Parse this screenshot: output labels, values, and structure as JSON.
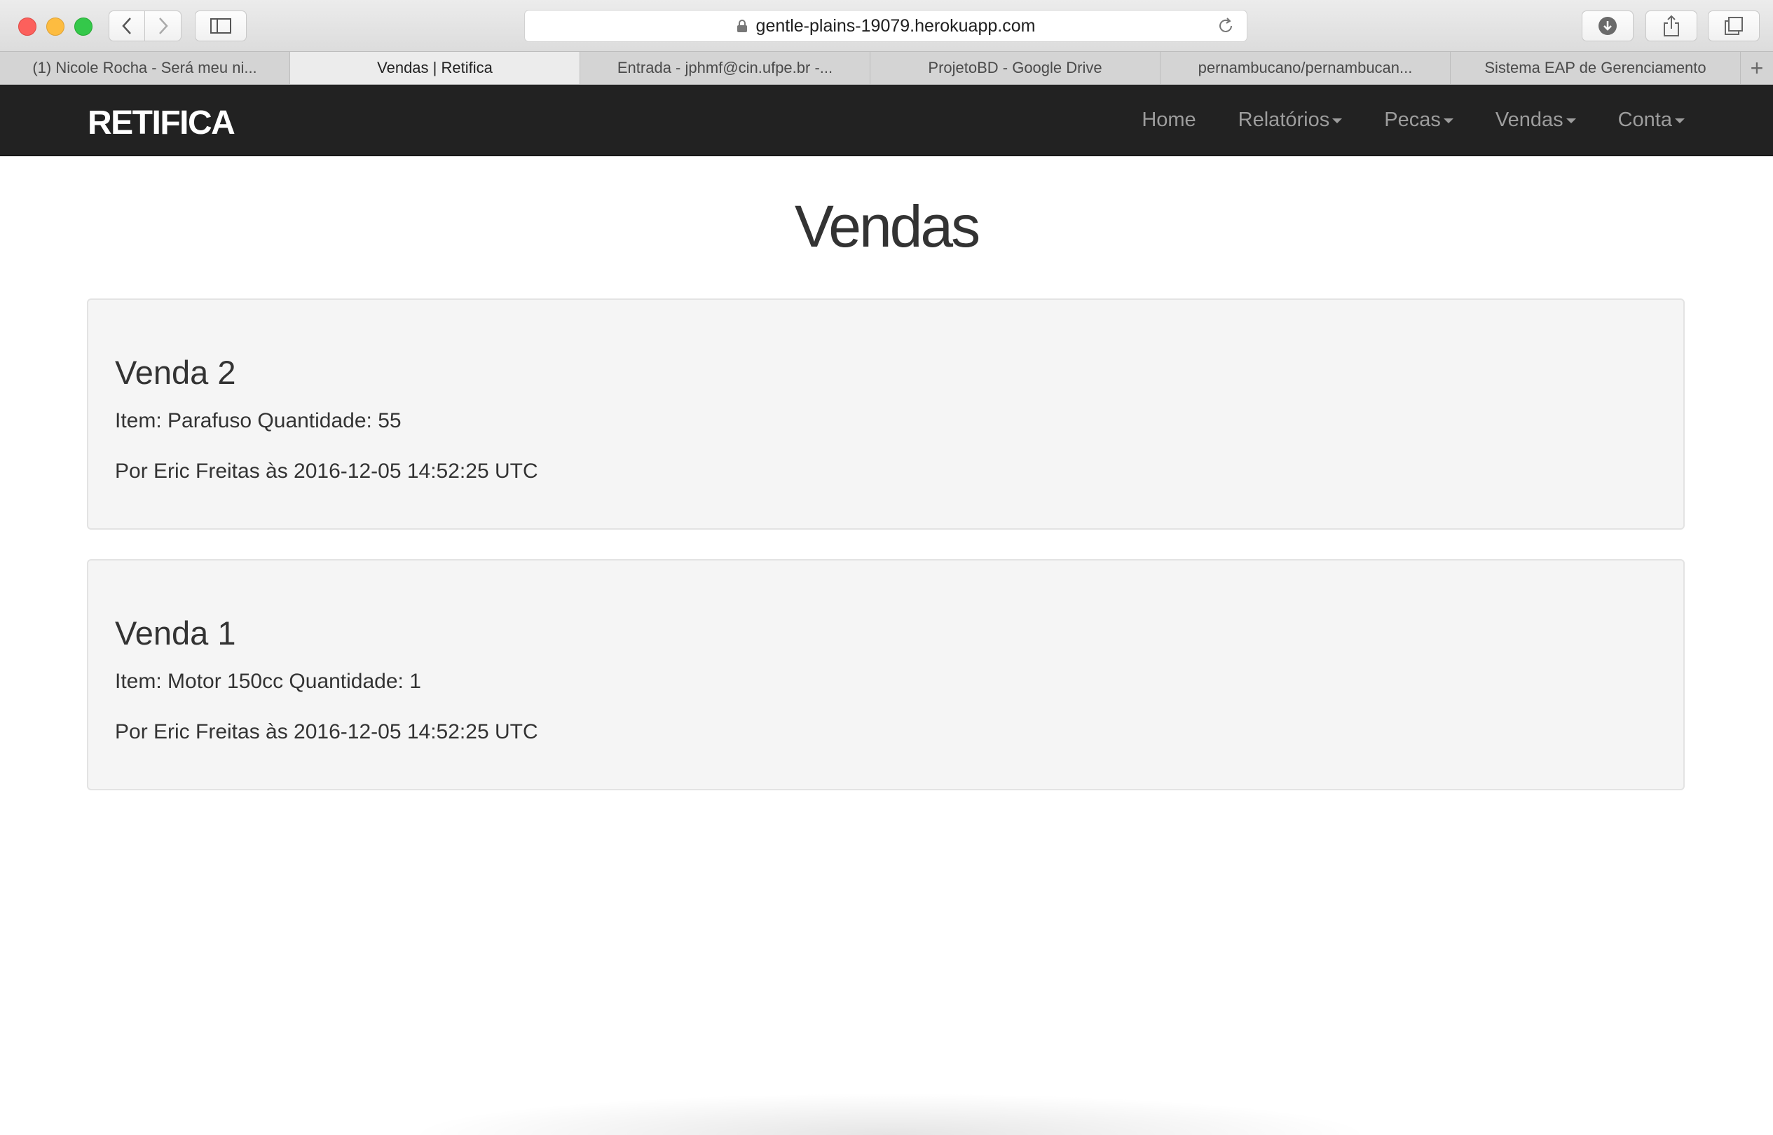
{
  "browser": {
    "url": "gentle-plains-19079.herokuapp.com",
    "tabs": [
      {
        "label": "(1) Nicole Rocha - Será meu ni..."
      },
      {
        "label": "Vendas | Retifica"
      },
      {
        "label": "Entrada - jphmf@cin.ufpe.br -..."
      },
      {
        "label": "ProjetoBD - Google Drive"
      },
      {
        "label": "pernambucano/pernambucan..."
      },
      {
        "label": "Sistema EAP de Gerenciamento"
      }
    ],
    "new_tab": "+"
  },
  "navbar": {
    "brand": "RETIFICA",
    "links": [
      {
        "label": "Home"
      },
      {
        "label": "Relatórios"
      },
      {
        "label": "Pecas"
      },
      {
        "label": "Vendas"
      },
      {
        "label": "Conta"
      }
    ]
  },
  "page": {
    "title": "Vendas",
    "sales": [
      {
        "title": "Venda 2",
        "item": "Item: Parafuso Quantidade: 55",
        "meta": "Por Eric Freitas às 2016-12-05 14:52:25 UTC"
      },
      {
        "title": "Venda 1",
        "item": "Item: Motor 150cc Quantidade: 1",
        "meta": "Por Eric Freitas às 2016-12-05 14:52:25 UTC"
      }
    ]
  },
  "colors": {
    "navbar_bg": "#222222",
    "card_bg": "#f5f5f5"
  }
}
